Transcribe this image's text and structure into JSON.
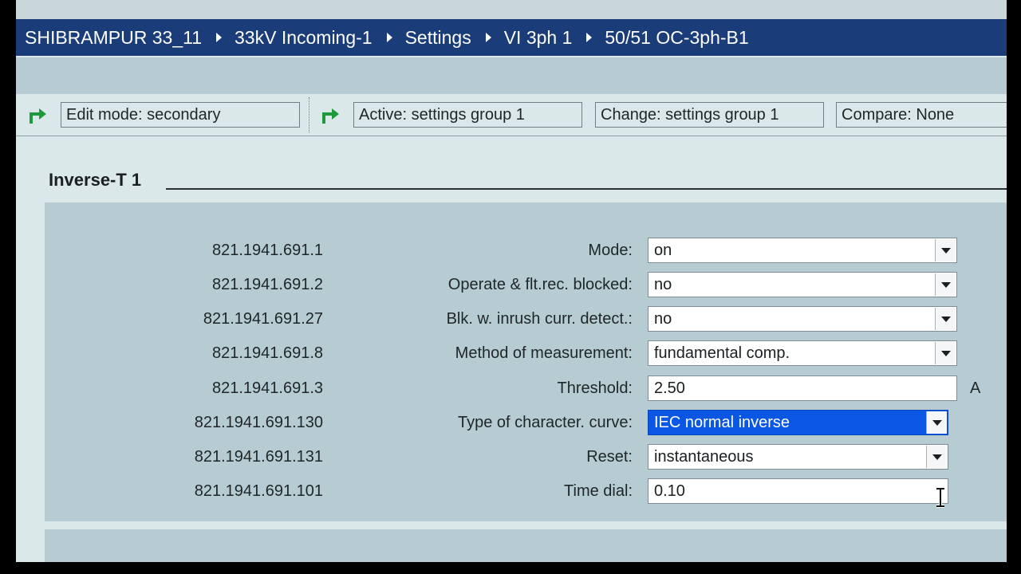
{
  "breadcrumb": [
    "SHIBRAMPUR 33_11",
    "33kV Incoming-1",
    "Settings",
    "VI 3ph 1",
    "50/51 OC-3ph-B1"
  ],
  "status": {
    "edit_mode": "Edit mode:  secondary",
    "active": "Active:  settings group 1",
    "change": "Change:  settings group 1",
    "compare": "Compare:  None"
  },
  "section": {
    "title": "Inverse-T 1"
  },
  "rows": [
    {
      "id": "821.1941.691.1",
      "label": "Mode:",
      "value": "on"
    },
    {
      "id": "821.1941.691.2",
      "label": "Operate & flt.rec. blocked:",
      "value": "no"
    },
    {
      "id": "821.1941.691.27",
      "label": "Blk. w. inrush curr. detect.:",
      "value": "no"
    },
    {
      "id": "821.1941.691.8",
      "label": "Method of measurement:",
      "value": "fundamental comp."
    },
    {
      "id": "821.1941.691.3",
      "label": "Threshold:",
      "value": "2.50",
      "unit": "A"
    },
    {
      "id": "821.1941.691.130",
      "label": "Type of character. curve:",
      "value": "IEC normal inverse"
    },
    {
      "id": "821.1941.691.131",
      "label": "Reset:",
      "value": "instantaneous"
    },
    {
      "id": "821.1941.691.101",
      "label": "Time dial:",
      "value": "0.10"
    }
  ],
  "colors": {
    "title_bar": "#1a3c78",
    "selection": "#0a57e6",
    "arrow": "#1e9a3c",
    "panel": "#b6ccd2"
  },
  "icons": {
    "status_arrow": "green-turn-right-arrow-icon",
    "cursor": "text-cursor-icon"
  }
}
